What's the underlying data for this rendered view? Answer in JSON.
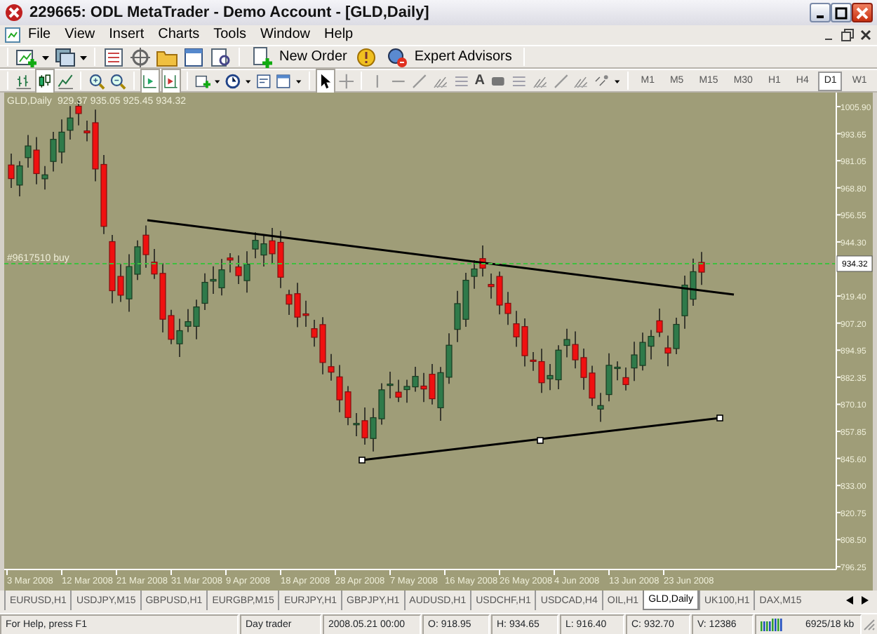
{
  "window": {
    "title": "229665: ODL MetaTrader - Demo Account - [GLD,Daily]"
  },
  "menu": [
    {
      "label": "File"
    },
    {
      "label": "View"
    },
    {
      "label": "Insert"
    },
    {
      "label": "Charts"
    },
    {
      "label": "Tools"
    },
    {
      "label": "Window"
    },
    {
      "label": "Help"
    }
  ],
  "toolbar": {
    "buttons": [
      {
        "label": "New Order"
      },
      {
        "label": "Expert Advisors"
      }
    ],
    "text_tool": "A"
  },
  "timeframes": [
    {
      "label": "M1",
      "selected": false
    },
    {
      "label": "M5",
      "selected": false
    },
    {
      "label": "M15",
      "selected": false
    },
    {
      "label": "M30",
      "selected": false
    },
    {
      "label": "H1",
      "selected": false
    },
    {
      "label": "H4",
      "selected": false
    },
    {
      "label": "D1",
      "selected": true
    },
    {
      "label": "W1",
      "selected": false
    }
  ],
  "chart": {
    "symbol": "GLD,Daily",
    "ohlc": "929.37 935.05 925.45 934.32",
    "order_label": "#9617510 buy",
    "current_price": "934.32",
    "price_labels": [
      "1005.90",
      "993.65",
      "981.05",
      "968.80",
      "956.55",
      "944.30",
      "919.40",
      "907.20",
      "894.95",
      "882.35",
      "870.10",
      "857.85",
      "845.60",
      "833.00",
      "820.75",
      "808.50",
      "796.25"
    ],
    "date_labels": [
      "3 Mar 2008",
      "12 Mar 2008",
      "21 Mar 2008",
      "31 Mar 2008",
      "9 Apr 2008",
      "18 Apr 2008",
      "28 Apr 2008",
      "7 May 2008",
      "16 May 2008",
      "26 May 2008",
      "4 Jun 2008",
      "13 Jun 2008",
      "23 Jun 2008"
    ]
  },
  "tabs": [
    {
      "label": "EURUSD,H1",
      "selected": false
    },
    {
      "label": "USDJPY,M15",
      "selected": false
    },
    {
      "label": "GBPUSD,H1",
      "selected": false
    },
    {
      "label": "EURGBP,M15",
      "selected": false
    },
    {
      "label": "EURJPY,H1",
      "selected": false
    },
    {
      "label": "GBPJPY,H1",
      "selected": false
    },
    {
      "label": "AUDUSD,H1",
      "selected": false
    },
    {
      "label": "USDCHF,H1",
      "selected": false
    },
    {
      "label": "USDCAD,H4",
      "selected": false
    },
    {
      "label": "OIL,H1",
      "selected": false
    },
    {
      "label": "GLD,Daily",
      "selected": true
    },
    {
      "label": "UK100,H1",
      "selected": false
    },
    {
      "label": "DAX,M15",
      "selected": false
    }
  ],
  "status_bar": [
    {
      "text": "For Help, press F1",
      "kind": "text"
    },
    {
      "text": "Day trader",
      "kind": "text"
    },
    {
      "text": "2008.05.21 00:00",
      "kind": "text"
    },
    {
      "text": "O: 918.95",
      "kind": "text"
    },
    {
      "text": "H: 934.65",
      "kind": "text"
    },
    {
      "text": "L: 916.40",
      "kind": "text"
    },
    {
      "text": "C: 932.70",
      "kind": "text"
    },
    {
      "text": "V: 12386",
      "kind": "text"
    },
    {
      "text": "6925/18 kb",
      "kind": "traffic"
    }
  ]
}
